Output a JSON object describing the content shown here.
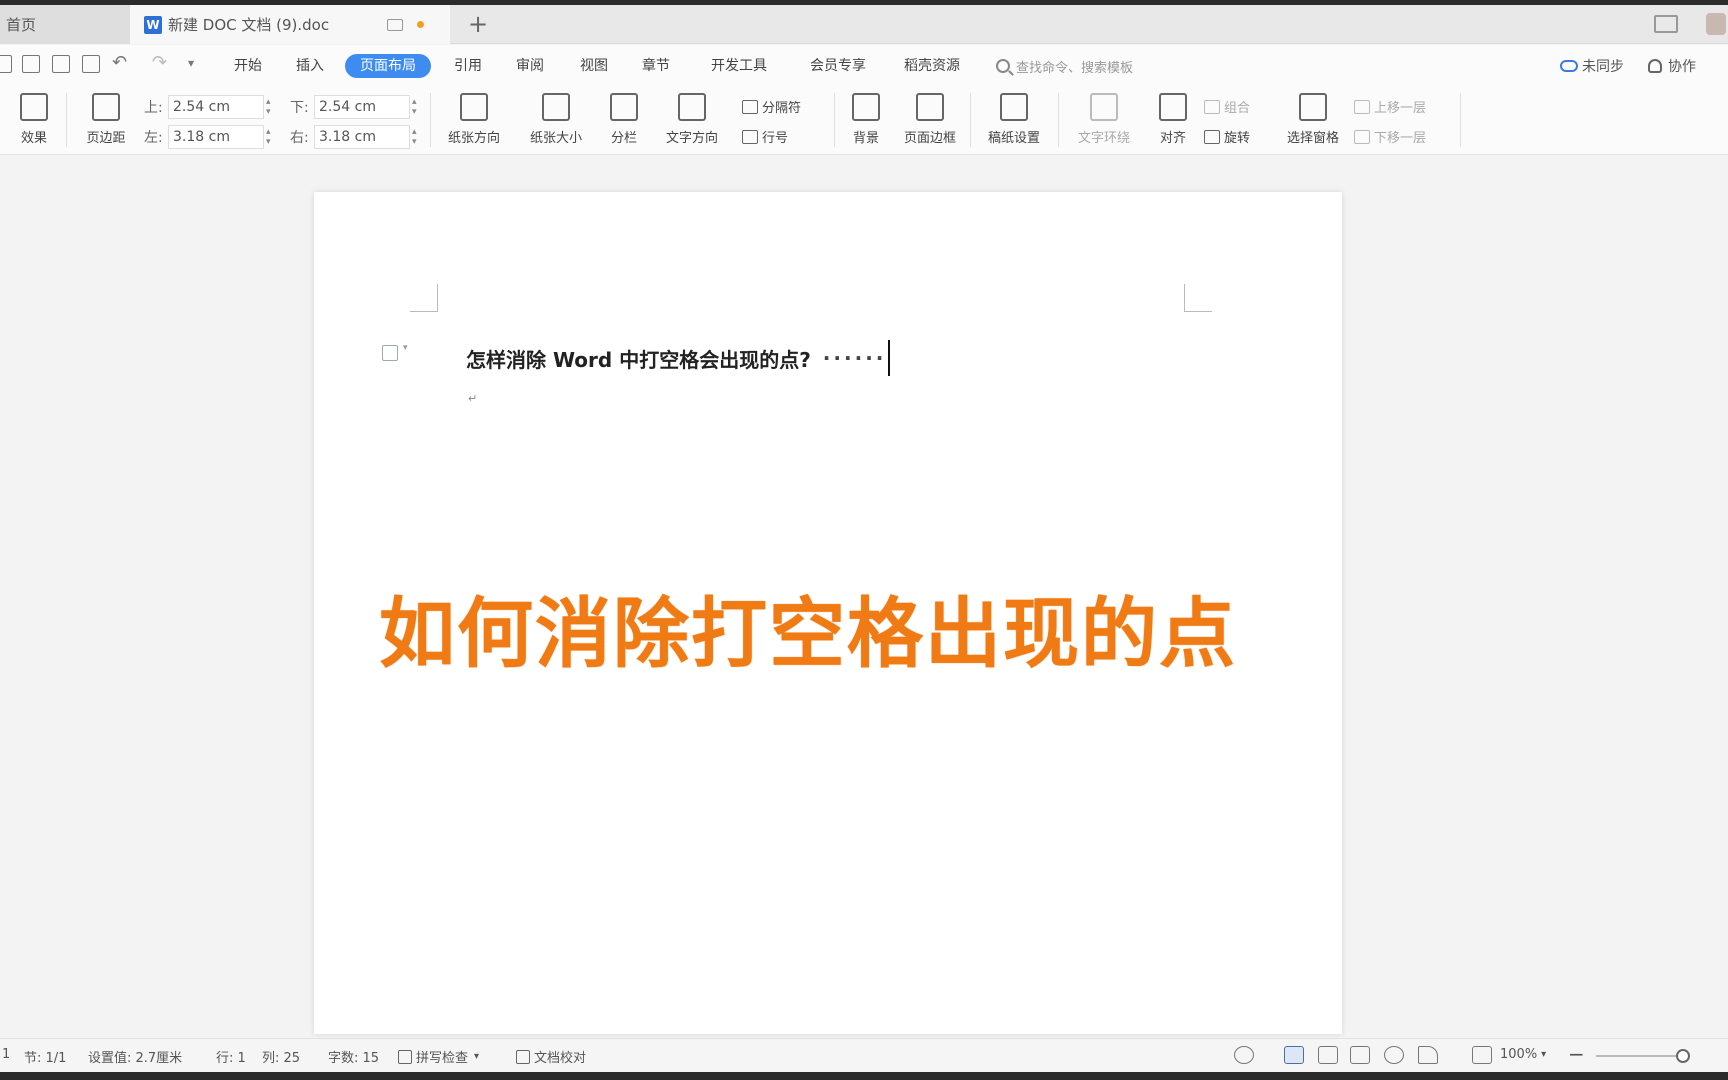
{
  "tabs": {
    "home_label": "首页",
    "doc_logo": "W",
    "doc_title": "新建 DOC 文档 (9).doc",
    "new_tab": "+"
  },
  "menu": {
    "items": [
      "开始",
      "插入",
      "页面布局",
      "引用",
      "审阅",
      "视图",
      "章节",
      "开发工具",
      "会员专享",
      "稻壳资源"
    ],
    "active": "页面布局",
    "search_placeholder": "查找命令、搜索模板",
    "sync": "未同步",
    "collab": "协作"
  },
  "ribbon": {
    "effects": "效果",
    "margins": "页边距",
    "top_label": "上:",
    "top_value": "2.54 cm",
    "bottom_label": "下:",
    "bottom_value": "2.54 cm",
    "left_label": "左:",
    "left_value": "3.18 cm",
    "right_label": "右:",
    "right_value": "3.18 cm",
    "orientation": "纸张方向",
    "size": "纸张大小",
    "columns": "分栏",
    "text_direction": "文字方向",
    "breaks": "分隔符",
    "line_numbers": "行号",
    "background": "背景",
    "page_border": "页面边框",
    "manuscript": "稿纸设置",
    "text_wrap": "文字环绕",
    "align": "对齐",
    "group": "组合",
    "rotate": "旋转",
    "selection_pane": "选择窗格",
    "bring_forward": "上移一层",
    "send_backward": "下移一层"
  },
  "document": {
    "heading": "怎样消除 Word 中打空格会出现的点?",
    "space_marks": "······",
    "para_mark": "↵"
  },
  "overlay_caption": "如何消除打空格出现的点",
  "status": {
    "page": "1",
    "section": "节: 1/1",
    "position": "设置值: 2.7厘米",
    "row": "行: 1",
    "col": "列: 25",
    "word_count": "字数: 15",
    "spell_check": "拼写检查",
    "doc_check": "文档校对",
    "zoom": "100%"
  },
  "colors": {
    "accent": "#3f8cf0",
    "overlay": "#f07a14"
  }
}
